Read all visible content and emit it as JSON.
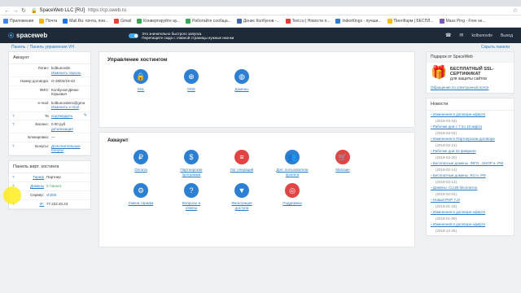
{
  "browser": {
    "site_label": "SpaceWeb LLC [RU]",
    "url": "https://cp.sweb.ru",
    "bookmarks": [
      "Приложения",
      "Почта",
      "Mail.Ru: почта, пои...",
      "Gmail",
      "Конвертируйте ау...",
      "Работайте сообща...",
      "Денис Колбунов -...",
      "Text.ru | Новости п...",
      "IndexKings - лучши...",
      "ПингФарм | БЕСПЛ...",
      "Mass Ping - Free se..."
    ],
    "bookmark_colors": [
      "#4285f4",
      "#f4b400",
      "#1a73e8",
      "#ea4335",
      "#34a853",
      "#34a853",
      "#4267b2",
      "#e53935",
      "#2d7dd2",
      "#fbbc05",
      "#7e57c2"
    ]
  },
  "header": {
    "logo": "spaceweb",
    "promo_line1": "Это значительно быстрого запуска.",
    "promo_line2": "Перетащите сюда с главной страницы нужные иконки",
    "username": "kolbunovde",
    "exit_label": "Выход"
  },
  "subheader": {
    "crumb1": "Панель",
    "crumb2": "Панель управления VH",
    "hide_label": "Скрыть панели"
  },
  "account": {
    "title": "Аккаунт",
    "rows": [
      {
        "k": "Логин:",
        "v": "kolbunovde",
        "link": "Изменить пароль"
      },
      {
        "k": "Номер договора:",
        "v": "О-28/02/19-42",
        "link": ""
      },
      {
        "k": "ФИО:",
        "v": "Колбунов Денис Юрьевич",
        "link": ""
      },
      {
        "k": "e-mail:",
        "v": "kolbunovdens@gma",
        "link": "Изменить e-mail"
      },
      {
        "k": "Те",
        "v": "",
        "link": "подтвердить"
      },
      {
        "k": "Баланс:",
        "v": "0.00 руб",
        "link": "детализация"
      },
      {
        "k": "Блокировка:",
        "v": "—",
        "link": ""
      },
      {
        "k": "Бонусы:",
        "v": "",
        "link": "Дополнительные бонусы"
      }
    ]
  },
  "hosting": {
    "title": "Панель вирт. хостинга",
    "rows": [
      {
        "k": "Тариф",
        "v": "Партнер"
      },
      {
        "k": "Домены",
        "v": "0 / много"
      },
      {
        "k": "Сервер:",
        "v": "vh285"
      },
      {
        "k": "IP:",
        "v": "77.222.40.43"
      }
    ]
  },
  "hosting_panel": {
    "title": "Управление хостингом",
    "tiles": [
      {
        "icon": "lock-icon",
        "glyph": "🔒",
        "label": "SSL",
        "label2": ""
      },
      {
        "icon": "globe-icon",
        "glyph": "⊕",
        "label": "DNS",
        "label2": ""
      },
      {
        "icon": "globe-icon",
        "glyph": "◍",
        "label": "Домены",
        "label2": ""
      }
    ]
  },
  "account_panel": {
    "title": "Аккаунт",
    "tiles": [
      {
        "icon": "coin-icon",
        "glyph": "₽",
        "label": "Оплата",
        "label2": "",
        "red": false
      },
      {
        "icon": "money-bag-icon",
        "glyph": "$",
        "label": "Партнерская",
        "label2": "программа",
        "red": false
      },
      {
        "icon": "list-icon",
        "glyph": "≡",
        "label": "Лог операций",
        "label2": "",
        "red": true
      },
      {
        "icon": "users-icon",
        "glyph": "👥",
        "label": "Доп. пользователи",
        "label2": "проекта",
        "red": false
      },
      {
        "icon": "cart-icon",
        "glyph": "🛒",
        "label": "Магазин",
        "label2": "",
        "red": true
      },
      {
        "icon": "gear-icon",
        "glyph": "⚙",
        "label": "Смена тарифа",
        "label2": "",
        "red": false
      },
      {
        "icon": "question-icon",
        "glyph": "?",
        "label": "Вопросы и",
        "label2": "ответы",
        "red": false
      },
      {
        "icon": "filter-icon",
        "glyph": "▼",
        "label": "Фильтрация",
        "label2": "доступа",
        "red": false
      },
      {
        "icon": "lifebuoy-icon",
        "glyph": "◎",
        "label": "Поддержка",
        "label2": "",
        "red": true
      }
    ]
  },
  "gift": {
    "head": "Подарок от SpaceWeb",
    "line1": "БЕСПЛАТНЫЙ SSL-",
    "line2": "СЕРТИФИКАТ",
    "line3": "для защиты сайтов",
    "link": "Обращение по электронной почте"
  },
  "news": {
    "title": "Новости",
    "items": [
      {
        "t": "Изменения в договоре-оферте",
        "d": "(2019-03-18)"
      },
      {
        "t": "Рабочие дни с 7 по 10 марта",
        "d": "(2019-03-04)"
      },
      {
        "t": "Изменения в Партнерском договоре",
        "d": "(2019-02-21)"
      },
      {
        "t": "Рабочие дни 22 февраля",
        "d": "(2019-02-20)"
      },
      {
        "t": "Бесплатные домены .INFO, .SHOP и .PW",
        "d": "(2019-02-14)"
      },
      {
        "t": "Бесплатные домены .RU и .РФ",
        "d": "(2019-02-13)"
      },
      {
        "t": "Домены .CLUB бесплатно",
        "d": "(2019-02-04)"
      },
      {
        "t": "Новый PHP 7.3!",
        "d": "(2019-01-18)"
      },
      {
        "t": "Изменения в договоре-оферте",
        "d": "(2019-01-09)"
      },
      {
        "t": "Изменения в договоре-оферте",
        "d": "(2018-12-26)"
      }
    ]
  }
}
